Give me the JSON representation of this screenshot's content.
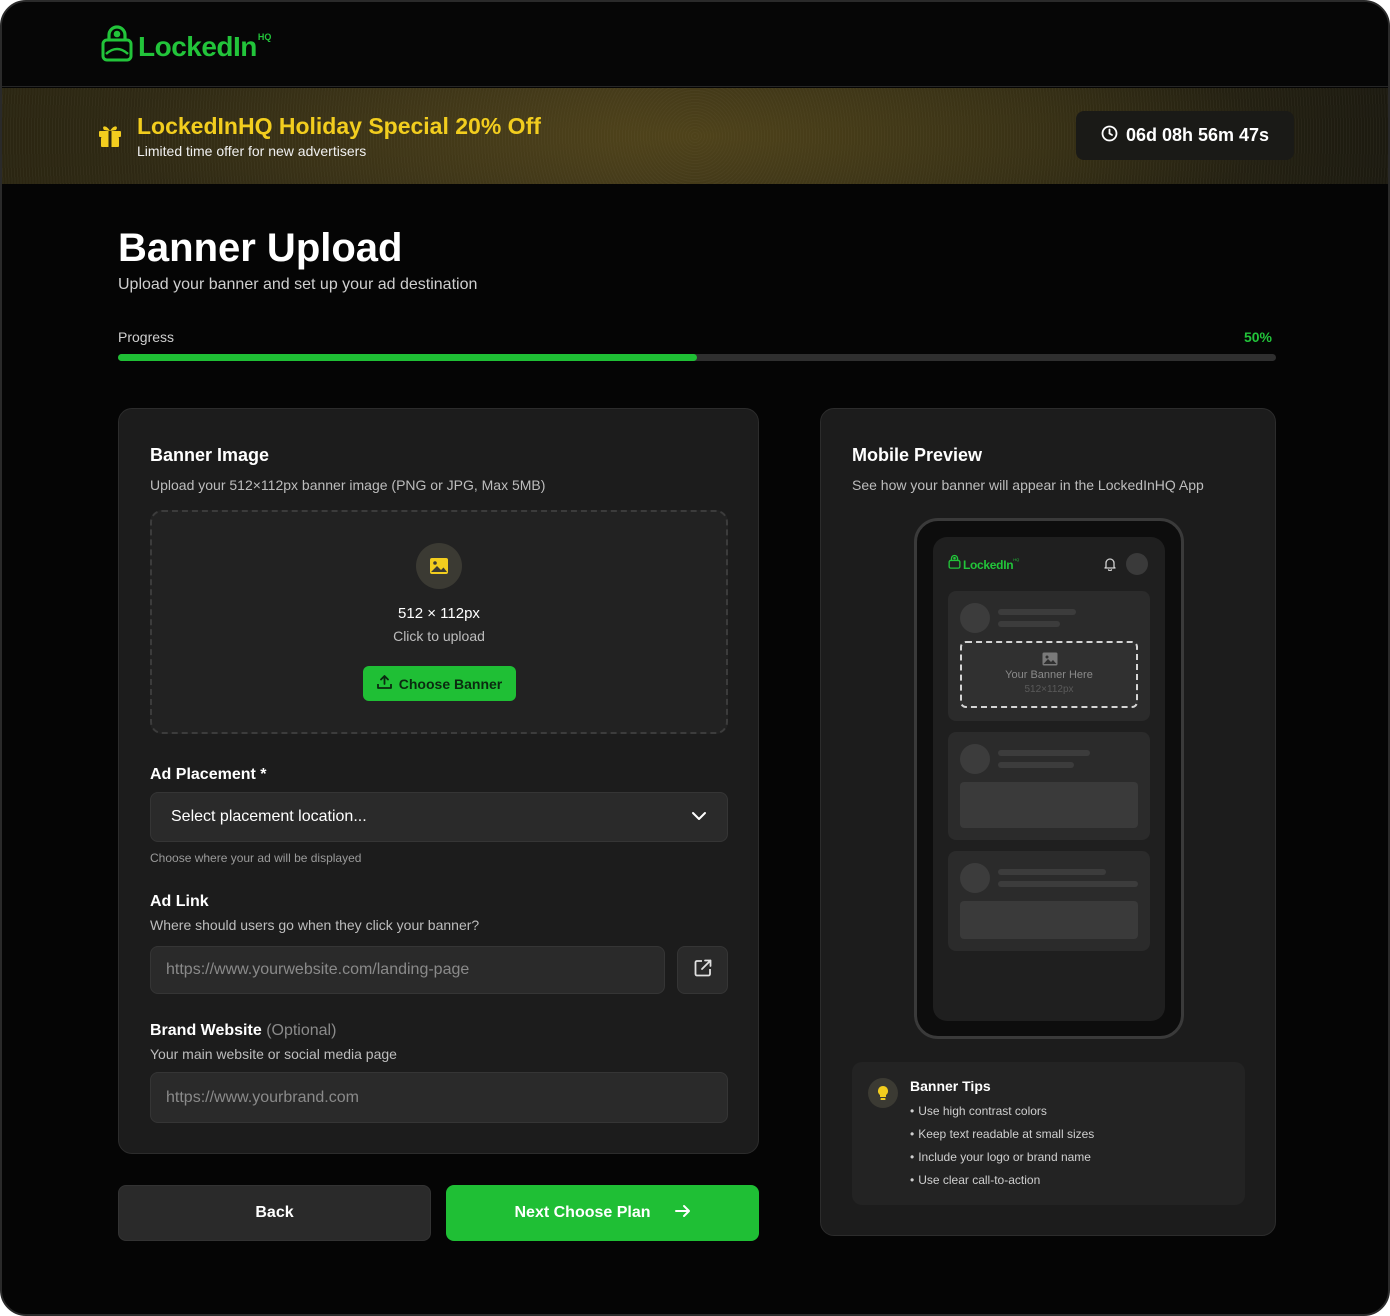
{
  "brand": {
    "logo_text": "LockedIn",
    "logo_sup": "HQ",
    "accent": "#1fbf35",
    "promo_color": "#f2cd1e"
  },
  "promo": {
    "title": "LockedInHQ Holiday Special 20% Off",
    "subtitle": "Limited time offer for new advertisers",
    "countdown": "06d 08h 56m 47s"
  },
  "page": {
    "title": "Banner Upload",
    "subtitle": "Upload your banner and set up your ad destination"
  },
  "progress": {
    "label": "Progress",
    "percent_text": "50%",
    "value": 0.5
  },
  "banner_image": {
    "title": "Banner Image",
    "subtitle": "Upload your 512×112px banner image (PNG or JPG, Max 5MB)",
    "size_text": "512 × 112px",
    "click_text": "Click to upload",
    "button_label": "Choose Banner"
  },
  "ad_placement": {
    "label": "Ad Placement *",
    "selected": "Select placement location...",
    "hint": "Choose where your ad will be displayed"
  },
  "ad_link": {
    "label": "Ad Link",
    "subtitle": "Where should users go when they click your banner?",
    "placeholder": "https://www.yourwebsite.com/landing-page"
  },
  "brand_website": {
    "label": "Brand Website",
    "optional": "(Optional)",
    "subtitle": "Your main website or social media page",
    "placeholder": "https://www.yourbrand.com"
  },
  "actions": {
    "back_label": "Back",
    "next_label": "Next Choose Plan"
  },
  "mobile_preview": {
    "title": "Mobile Preview",
    "subtitle": "See how your banner will appear in the LockedInHQ App",
    "phone_logo": "LockedIn",
    "phone_logo_sup": "HQ",
    "banner_placeholder": "Your Banner Here",
    "banner_size": "512×112px"
  },
  "tips": {
    "title": "Banner Tips",
    "items": [
      "Use high contrast colors",
      "Keep text readable at small sizes",
      "Include your logo or brand name",
      "Use clear call-to-action"
    ]
  },
  "icons": [
    "lock-logo-icon",
    "gift-icon",
    "clock-icon",
    "image-icon",
    "upload-icon",
    "chevron-down-icon",
    "external-link-icon",
    "arrow-right-icon",
    "bell-icon",
    "lightbulb-icon"
  ]
}
